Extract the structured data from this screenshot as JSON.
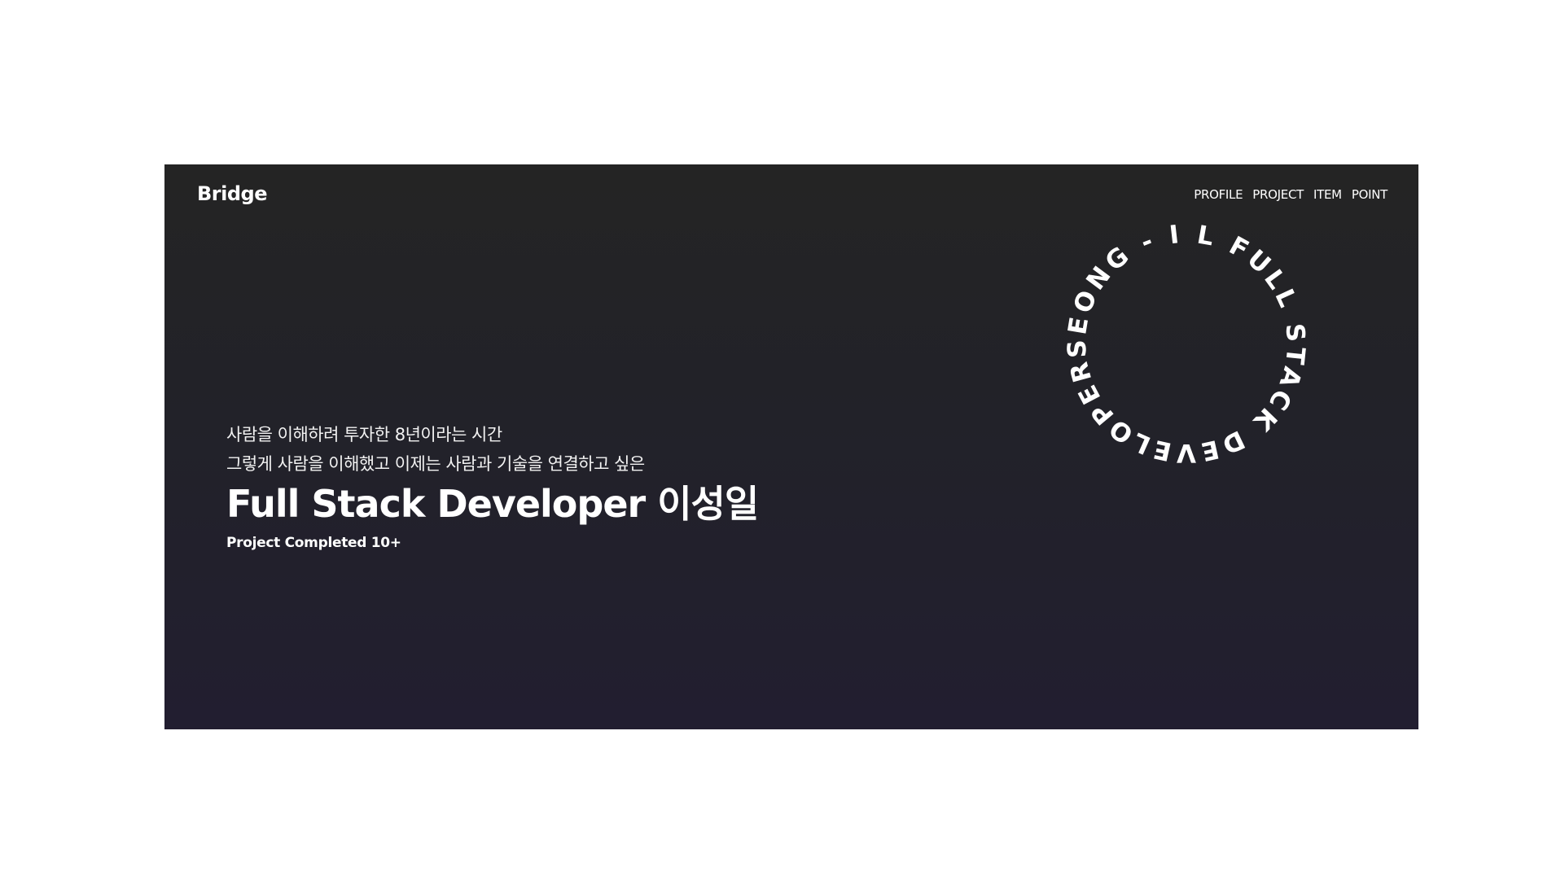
{
  "header": {
    "logo": "Bridge",
    "nav": [
      {
        "label": "PROFILE"
      },
      {
        "label": "PROJECT"
      },
      {
        "label": "ITEM"
      },
      {
        "label": "POINT"
      }
    ]
  },
  "hero": {
    "line1": "사람을 이해하려 투자한 8년이라는 시간",
    "line2": "그렇게 사람을 이해했고 이제는 사람과 기술을 연결하고 싶은",
    "headline": "Full Stack Developer 이성일",
    "meta": "Project Completed 10+"
  },
  "badge": {
    "circular_text": "SEONG - I L FULL   STACK   DEVELOPER   "
  },
  "colors": {
    "page_bg": "#ffffff",
    "hero_bg_top": "#242424",
    "hero_bg_bottom": "#221e30",
    "text": "#ffffff"
  }
}
